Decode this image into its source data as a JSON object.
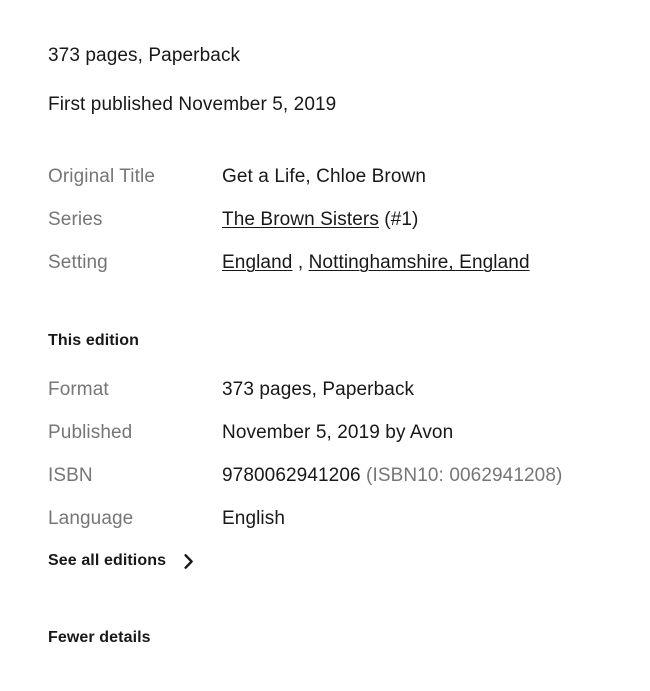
{
  "summary": {
    "format_line": "373 pages, Paperback",
    "first_published_line": "First published November 5, 2019"
  },
  "work_details": {
    "rows": [
      {
        "label": "Original Title",
        "value": "Get a Life, Chloe Brown"
      },
      {
        "label": "Series",
        "link_text": "The Brown Sisters",
        "suffix": " (#1)"
      },
      {
        "label": "Setting",
        "link_text": "England",
        "separator": " , ",
        "link_text_2": "Nottinghamshire, England"
      }
    ]
  },
  "edition": {
    "heading": "This edition",
    "rows": [
      {
        "label": "Format",
        "value": "373 pages, Paperback"
      },
      {
        "label": "Published",
        "value": "November 5, 2019 by Avon"
      },
      {
        "label": "ISBN",
        "value": "9780062941206",
        "secondary": " (ISBN10: 0062941208)"
      },
      {
        "label": "Language",
        "value": "English"
      }
    ],
    "see_all_editions_label": "See all editions",
    "chevron_icon": "chevron-right-icon"
  },
  "footer": {
    "fewer_details_label": "Fewer details"
  },
  "colors": {
    "text": "#181818",
    "muted": "#767676",
    "background": "#ffffff"
  }
}
